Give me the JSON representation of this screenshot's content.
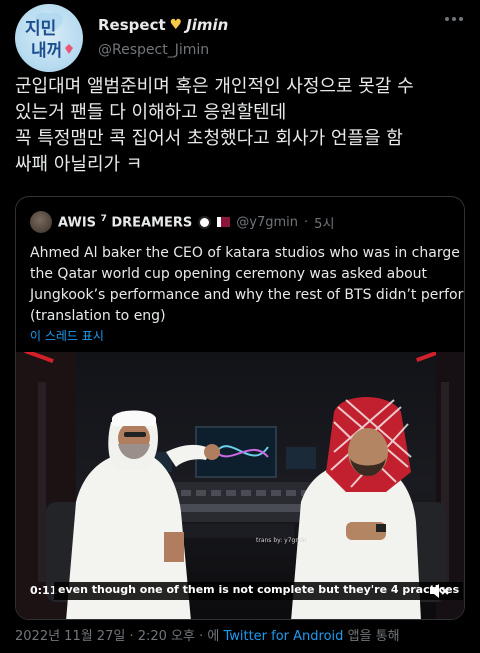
{
  "author": {
    "name": "Respect",
    "name_suffix": "Jimin",
    "heart_icon": "yellow-heart-icon",
    "handle": "@Respect_Jimin",
    "avatar_text": "지민내꺼"
  },
  "tweet": {
    "lines": [
      "군입대며 앨범준비며 혹은 개인적인 사정으로 못갈 수",
      "있는거 팬들 다 이해하고 응원할텐데",
      "꼭 특정맴만 콕 집어서 초청했다고 회사가 언플을 함",
      "싸패 아닐리가 ㅋ"
    ]
  },
  "quote": {
    "name": "AWIS",
    "name_sup": "7",
    "name_rest": "DREAMERS",
    "handle": "@y7gmin",
    "separator": "·",
    "time": "5시",
    "text_lines": [
      "Ahmed Al baker the CEO of katara studios who was in charge of",
      "the Qatar world cup opening ceremony was asked about",
      "Jungkook’s performance and why the rest of BTS didn’t perform",
      "(translation to eng)"
    ],
    "show_thread": "이 스레드 표시",
    "video": {
      "elapsed": "0:11",
      "subtitle": "even though one of them is not complete but they're 4 practices",
      "watermark": "trans by: y7gmin"
    }
  },
  "footer": {
    "date": "2022년 11월 27일 · 2:20 오후 · 에 ",
    "client": "Twitter for Android",
    "suffix": " 앱을 통해"
  },
  "colors": {
    "link": "#1d9bf0",
    "muted": "#71767b",
    "text": "#e7e9ea"
  }
}
